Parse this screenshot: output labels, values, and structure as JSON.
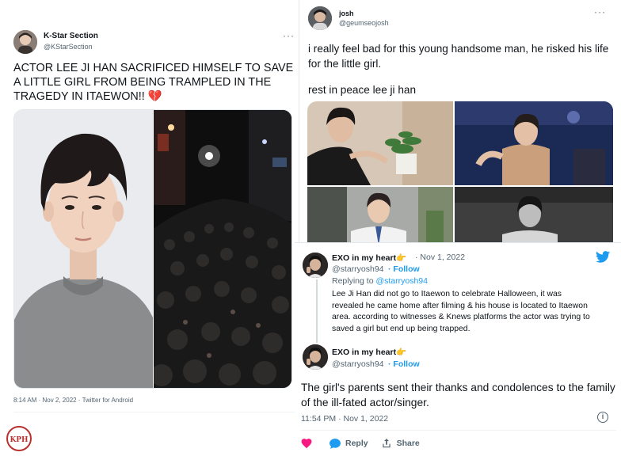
{
  "left_tweet": {
    "name": "K-Star Section",
    "handle": "@KStarSection",
    "more": "···",
    "text": "ACTOR LEE JI HAN SACRIFICED HIMSELF TO SAVE A LITTLE GIRL FROM BEING TRAMPLED IN THE TRAGEDY IN ITAEWON!!",
    "emoji": "💔",
    "meta": "8:14 AM · Nov 2, 2022 · Twitter for Android"
  },
  "right_top_tweet": {
    "name": "josh",
    "handle": "@geumseojosh",
    "more": "···",
    "text_1": "i really feel bad for this young handsome man, he risked his life for the little girl.",
    "text_2": "rest in peace lee ji han"
  },
  "right_bottom_tweet": {
    "reply": {
      "name": "EXO in my heart",
      "emoji": "👉",
      "date": "· Nov 1, 2022",
      "handle": "@starryosh94",
      "follow": "· Follow",
      "replying_prefix": "Replying to ",
      "replying_to": "@starryosh94",
      "text": "Lee Ji Han did not go to Itaewon to celebrate Halloween, it was revealed he came home after filming & his house is located to Itaewon area. according to witnesses & Knews platforms the actor was trying to saved a girl but end up being trapped."
    },
    "main": {
      "name": "EXO in my heart",
      "emoji": "👉",
      "handle": "@starryosh94",
      "follow": "· Follow",
      "text": "The girl's parents sent their thanks and condolences to the family of the ill-fated actor/singer.",
      "time": "11:54 PM · Nov 1, 2022",
      "info": "i"
    },
    "actions": {
      "reply": "Reply",
      "share": "Share"
    }
  },
  "watermark": "KPH",
  "colors": {
    "twitter_blue": "#1d9bf0",
    "like_pink": "#f91880",
    "text": "#0f1419",
    "secondary": "#536471"
  }
}
